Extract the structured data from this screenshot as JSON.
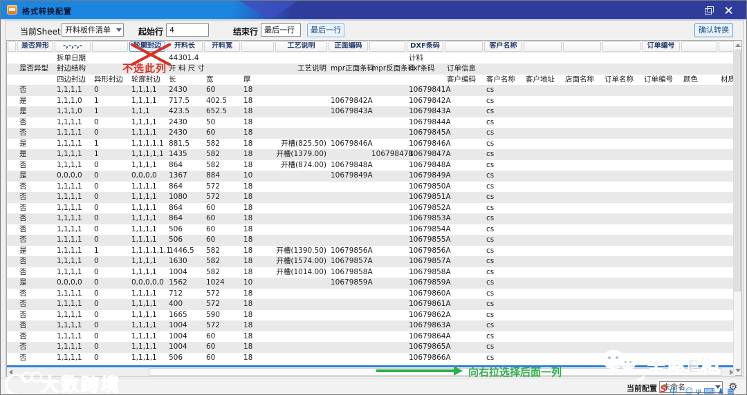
{
  "window": {
    "title": "格式转换配置"
  },
  "toolbar": {
    "sheet_label": "当前Sheet",
    "sheet_value": "开料板件清单",
    "start_row_label": "起始行",
    "start_row_value": "4",
    "end_row_label": "结束行",
    "end_row_value": "最后一行",
    "last_row_button": "最后一行",
    "confirm_button": "确认转换"
  },
  "grid": {
    "mapping": [
      "",
      "是否异形",
      "-,-,-,-",
      "",
      "轮廓封边",
      "开料长",
      "开料宽",
      "",
      "工艺说明",
      "正面编码",
      "",
      "DXF条码",
      "",
      "客户名称",
      "",
      "",
      "",
      "订单编号",
      "",
      ""
    ],
    "selected_col_index": 4,
    "preview_rows": [
      [
        "",
        "拆单日期",
        "",
        "",
        "44301.4",
        "",
        "",
        "",
        "",
        "",
        "计料",
        "",
        "",
        "",
        "",
        "",
        "",
        "",
        ""
      ],
      [
        "是否异型",
        "封边结构",
        "",
        "",
        "开 料 尺 寸",
        "",
        "",
        "工艺说明",
        "mpr正面条码",
        "mpr反面条码",
        "dxf条码",
        "订单信息",
        "",
        "",
        "",
        "",
        "",
        "",
        ""
      ],
      [
        "",
        "四边封边",
        "异形封边",
        "轮廓封边",
        "长",
        "宽",
        "厚",
        "",
        "",
        "",
        "",
        "客户编码",
        "客户名称",
        "客户地址",
        "店面名称",
        "订单名称",
        "订单编号",
        "颜色",
        "材质"
      ]
    ],
    "rows": [
      [
        "否",
        "1,1,1,1",
        "0",
        "1,1,1,1",
        "2430",
        "60",
        "18",
        "",
        "",
        "",
        "10679841A",
        "",
        "cs"
      ],
      [
        "是",
        "1,1,1,0",
        "1",
        "1,1,1,1",
        "717.5",
        "402.5",
        "18",
        "",
        "10679842A",
        "",
        "10679842A",
        "",
        "cs"
      ],
      [
        "是",
        "1,1,1,0",
        "1",
        "1,1,1",
        "423.5",
        "652.5",
        "18",
        "",
        "10679843A",
        "",
        "10679843A",
        "",
        "cs"
      ],
      [
        "否",
        "1,1,1,1",
        "0",
        "1,1,1,1",
        "2430",
        "50",
        "18",
        "",
        "",
        "",
        "10679844A",
        "",
        "cs"
      ],
      [
        "否",
        "1,1,1,1",
        "0",
        "1,1,1,1",
        "2430",
        "60",
        "18",
        "",
        "",
        "",
        "10679845A",
        "",
        "cs"
      ],
      [
        "是",
        "1,1,1,1",
        "1",
        "1,1,1,1,1",
        "881.5",
        "582",
        "18",
        "开槽(825.50)",
        "10679846A",
        "",
        "10679846A",
        "",
        "cs"
      ],
      [
        "是",
        "1,1,1,1",
        "1",
        "1,1,1,1,1",
        "1435",
        "582",
        "18",
        "开槽(1379.00)",
        "",
        "10679847B",
        "10679847A",
        "",
        "cs"
      ],
      [
        "否",
        "1,1,1,1",
        "0",
        "1,1,1,1",
        "864",
        "582",
        "18",
        "开槽(874.00)",
        "10679848A",
        "",
        "10679848A",
        "",
        "cs"
      ],
      [
        "是",
        "0,0,0,0",
        "0",
        "0,0,0,0",
        "1367",
        "884",
        "10",
        "",
        "10679849A",
        "",
        "10679849A",
        "",
        "cs"
      ],
      [
        "否",
        "1,1,1,1",
        "0",
        "1,1,1,1",
        "864",
        "572",
        "18",
        "",
        "",
        "",
        "10679850A",
        "",
        "cs"
      ],
      [
        "否",
        "1,1,1,1",
        "0",
        "1,1,1,1",
        "1080",
        "572",
        "18",
        "",
        "",
        "",
        "10679851A",
        "",
        "cs"
      ],
      [
        "否",
        "1,1,1,1",
        "0",
        "1,1,1,1",
        "864",
        "60",
        "18",
        "",
        "",
        "",
        "10679852A",
        "",
        "cs"
      ],
      [
        "否",
        "1,1,1,1",
        "0",
        "1,1,1,1",
        "864",
        "60",
        "18",
        "",
        "",
        "",
        "10679853A",
        "",
        "cs"
      ],
      [
        "否",
        "1,1,1,1",
        "0",
        "1,1,1,1",
        "506",
        "60",
        "18",
        "",
        "",
        "",
        "10679854A",
        "",
        "cs"
      ],
      [
        "否",
        "1,1,1,1",
        "0",
        "1,1,1,1",
        "506",
        "60",
        "18",
        "",
        "",
        "",
        "10679855A",
        "",
        "cs"
      ],
      [
        "是",
        "1,1,1,1",
        "1",
        "1,1,1,1,1,1",
        "1446.5",
        "582",
        "18",
        "开槽(1390.50)",
        "10679856A",
        "",
        "10679856A",
        "",
        "cs"
      ],
      [
        "否",
        "1,1,1,1",
        "0",
        "1,1,1,1",
        "1630",
        "582",
        "18",
        "开槽(1574.00)",
        "10679857A",
        "",
        "10679857A",
        "",
        "cs"
      ],
      [
        "否",
        "1,1,1,1",
        "0",
        "1,1,1,1",
        "1004",
        "582",
        "18",
        "开槽(1014.00)",
        "10679858A",
        "",
        "10679858A",
        "",
        "cs"
      ],
      [
        "是",
        "0,0,0,0",
        "0",
        "0,0,0,0,0",
        "1562",
        "1024",
        "10",
        "",
        "10679859A",
        "",
        "10679859A",
        "",
        "cs"
      ],
      [
        "否",
        "1,1,1,1",
        "0",
        "1,1,1,1",
        "712",
        "572",
        "18",
        "",
        "",
        "",
        "10679860A",
        "",
        "cs"
      ],
      [
        "否",
        "1,1,1,1",
        "0",
        "1,1,1,1",
        "400",
        "572",
        "18",
        "",
        "",
        "",
        "10679861A",
        "",
        "cs"
      ],
      [
        "否",
        "1,1,1,1",
        "0",
        "1,1,1,1",
        "1665",
        "590",
        "18",
        "",
        "",
        "",
        "10679862A",
        "",
        "cs"
      ],
      [
        "否",
        "1,1,1,1",
        "0",
        "1,1,1,1",
        "1004",
        "572",
        "18",
        "",
        "",
        "",
        "10679863A",
        "",
        "cs"
      ],
      [
        "否",
        "1,1,1,1",
        "0",
        "1,1,1,1",
        "1004",
        "60",
        "18",
        "",
        "",
        "",
        "10679864A",
        "",
        "cs"
      ],
      [
        "否",
        "1,1,1,1",
        "0",
        "1,1,1,1",
        "1004",
        "60",
        "18",
        "",
        "",
        "",
        "10679865A",
        "",
        "cs"
      ],
      [
        "否",
        "1,1,1,1",
        "0",
        "1,1,1,1",
        "506",
        "60",
        "18",
        "",
        "",
        "",
        "10679866A",
        "",
        "cs"
      ]
    ]
  },
  "annotations": {
    "dont_select": "不选此列",
    "drag_right": "向右拉选择后面一列"
  },
  "statusbar": {
    "config_label": "当前配置",
    "config_value": "未命名"
  },
  "input_bar": {
    "logo": "S",
    "items": [
      "中",
      "’",
      "☺",
      "ψ",
      "⌨",
      "♟",
      "▦"
    ]
  },
  "watermarks": {
    "left": "大数跨境",
    "right": "全屋E柜"
  }
}
